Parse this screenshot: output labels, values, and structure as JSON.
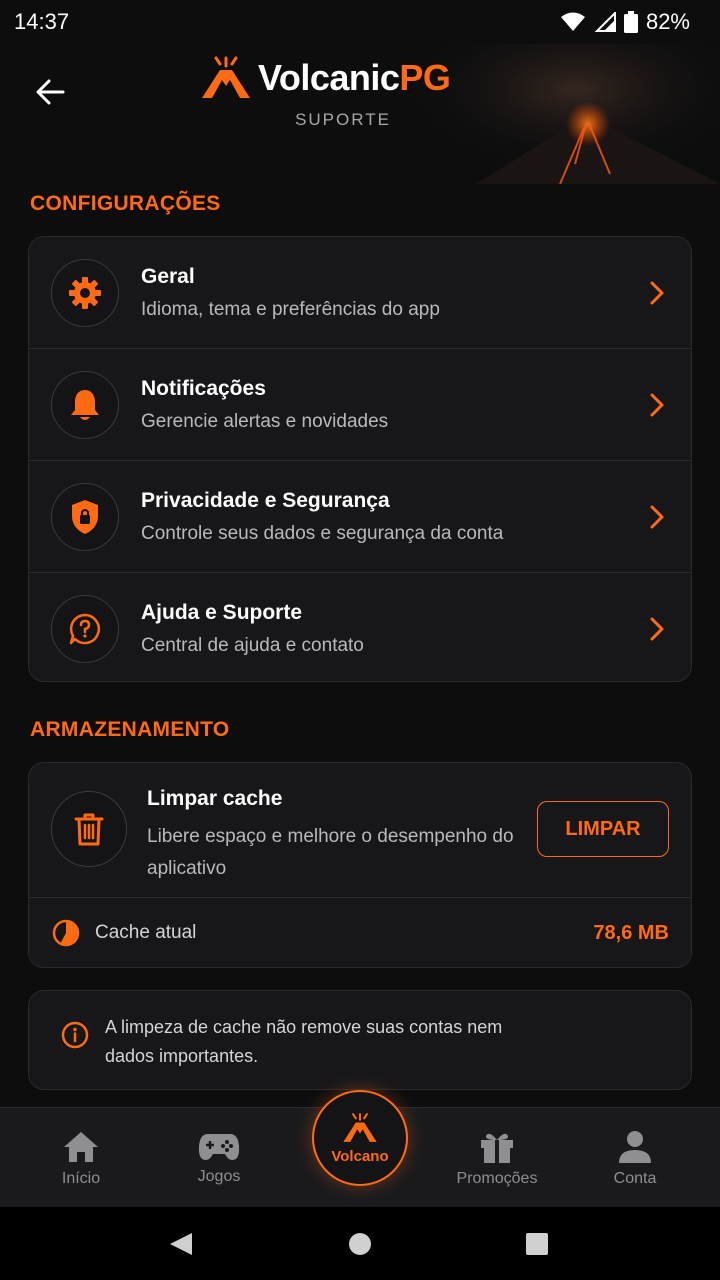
{
  "status_bar": {
    "time": "14:37",
    "battery": "82%"
  },
  "header": {
    "logo_primary": "Volcanic",
    "logo_accent": "PG",
    "subtitle": "SUPORTE"
  },
  "sections": {
    "settings_title": "CONFIGURAÇÕES",
    "storage_title": "ARMAZENAMENTO"
  },
  "settings": [
    {
      "title": "Geral",
      "subtitle": "Idioma, tema e preferências do app",
      "icon": "gear-icon"
    },
    {
      "title": "Notificações",
      "subtitle": "Gerencie alertas e novidades",
      "icon": "bell-icon"
    },
    {
      "title": "Privacidade e Segurança",
      "subtitle": "Controle seus dados e segurança da conta",
      "icon": "shield-lock-icon"
    },
    {
      "title": "Ajuda e Suporte",
      "subtitle": "Central de ajuda e contato",
      "icon": "help-chat-icon"
    }
  ],
  "storage": {
    "title": "Limpar cache",
    "subtitle": "Libere espaço e melhore o desempenho do aplicativo",
    "button_label": "LIMPAR",
    "cache_label": "Cache atual",
    "cache_value": "78,6 MB"
  },
  "info": {
    "text": "A limpeza de cache não remove suas contas nem dados importantes."
  },
  "bottom_nav": [
    {
      "label": "Início",
      "icon": "home-icon"
    },
    {
      "label": "Jogos",
      "icon": "gamepad-icon"
    },
    {
      "label": "Volcano",
      "icon": "volcano-icon"
    },
    {
      "label": "Promoções",
      "icon": "gift-icon"
    },
    {
      "label": "Conta",
      "icon": "user-icon"
    }
  ],
  "colors": {
    "accent": "#ff6a13",
    "background": "#0d0d0e",
    "card": "#17171a",
    "muted_text": "#b9b9bd"
  }
}
